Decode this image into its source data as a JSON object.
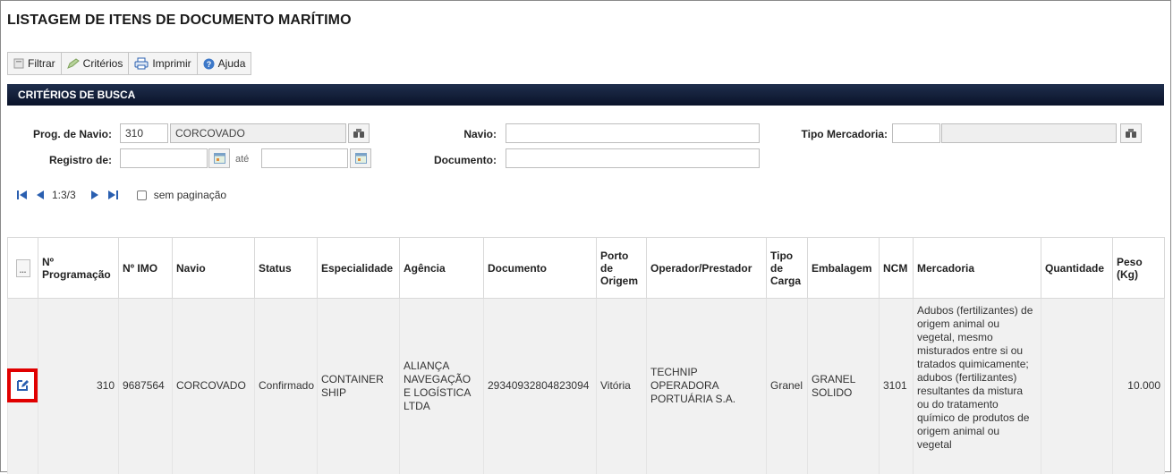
{
  "page": {
    "title": "LISTAGEM DE ITENS DE DOCUMENTO MARÍTIMO"
  },
  "toolbar": {
    "filtrar": "Filtrar",
    "criterios": "Critérios",
    "imprimir": "Imprimir",
    "ajuda": "Ajuda"
  },
  "section": {
    "title": "CRITÉRIOS DE BUSCA"
  },
  "form": {
    "prog_navio_label": "Prog. de Navio:",
    "prog_navio_value": "310",
    "prog_navio_desc": "CORCOVADO",
    "registro_label": "Registro de:",
    "registro_from": "",
    "ate_label": "até",
    "registro_to": "",
    "navio_label": "Navio:",
    "navio_value": "",
    "documento_label": "Documento:",
    "documento_value": "",
    "tipo_merc_label": "Tipo Mercadoria:",
    "tipo_merc_code": "",
    "tipo_merc_desc": ""
  },
  "pager": {
    "range": "1:3/3",
    "sem_paginacao": "sem paginação"
  },
  "table": {
    "more_button": "...",
    "headers": [
      "Nº Programação",
      "Nº IMO",
      "Navio",
      "Status",
      "Especialidade",
      "Agência",
      "Documento",
      "Porto de Origem",
      "Operador/Prestador",
      "Tipo de Carga",
      "Embalagem",
      "NCM",
      "Mercadoria",
      "Quantidade",
      "Peso (Kg)"
    ],
    "row": {
      "programacao": "310",
      "imo": "9687564",
      "navio": "CORCOVADO",
      "status": "Confirmado",
      "especialidade": "CONTAINER SHIP",
      "agencia": "ALIANÇA NAVEGAÇÃO E LOGÍSTICA LTDA",
      "documento": "29340932804823094",
      "porto": "Vitória",
      "operador": "TECHNIP OPERADORA PORTUÁRIA S.A.",
      "tipo_carga": "Granel",
      "embalagem": "GRANEL SOLIDO",
      "ncm": "3101",
      "mercadoria": "Adubos (fertilizantes) de origem animal ou vegetal, mesmo misturados entre si ou tratados quimicamente; adubos (fertilizantes) resultantes da mistura ou do tratamento químico de produtos de origem animal ou vegetal",
      "quantidade": "",
      "peso": "10.000"
    }
  },
  "colors": {
    "header_bar": "#0a1329",
    "highlight": "#e00000",
    "icon_blue": "#2a5fb0"
  }
}
